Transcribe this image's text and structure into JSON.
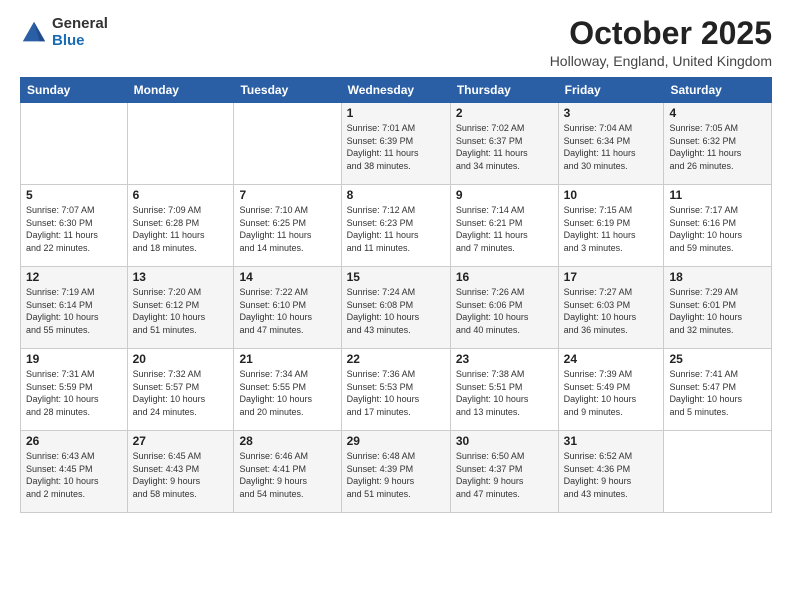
{
  "header": {
    "logo_general": "General",
    "logo_blue": "Blue",
    "month_title": "October 2025",
    "location": "Holloway, England, United Kingdom"
  },
  "days_of_week": [
    "Sunday",
    "Monday",
    "Tuesday",
    "Wednesday",
    "Thursday",
    "Friday",
    "Saturday"
  ],
  "weeks": [
    [
      {
        "num": "",
        "info": ""
      },
      {
        "num": "",
        "info": ""
      },
      {
        "num": "",
        "info": ""
      },
      {
        "num": "1",
        "info": "Sunrise: 7:01 AM\nSunset: 6:39 PM\nDaylight: 11 hours\nand 38 minutes."
      },
      {
        "num": "2",
        "info": "Sunrise: 7:02 AM\nSunset: 6:37 PM\nDaylight: 11 hours\nand 34 minutes."
      },
      {
        "num": "3",
        "info": "Sunrise: 7:04 AM\nSunset: 6:34 PM\nDaylight: 11 hours\nand 30 minutes."
      },
      {
        "num": "4",
        "info": "Sunrise: 7:05 AM\nSunset: 6:32 PM\nDaylight: 11 hours\nand 26 minutes."
      }
    ],
    [
      {
        "num": "5",
        "info": "Sunrise: 7:07 AM\nSunset: 6:30 PM\nDaylight: 11 hours\nand 22 minutes."
      },
      {
        "num": "6",
        "info": "Sunrise: 7:09 AM\nSunset: 6:28 PM\nDaylight: 11 hours\nand 18 minutes."
      },
      {
        "num": "7",
        "info": "Sunrise: 7:10 AM\nSunset: 6:25 PM\nDaylight: 11 hours\nand 14 minutes."
      },
      {
        "num": "8",
        "info": "Sunrise: 7:12 AM\nSunset: 6:23 PM\nDaylight: 11 hours\nand 11 minutes."
      },
      {
        "num": "9",
        "info": "Sunrise: 7:14 AM\nSunset: 6:21 PM\nDaylight: 11 hours\nand 7 minutes."
      },
      {
        "num": "10",
        "info": "Sunrise: 7:15 AM\nSunset: 6:19 PM\nDaylight: 11 hours\nand 3 minutes."
      },
      {
        "num": "11",
        "info": "Sunrise: 7:17 AM\nSunset: 6:16 PM\nDaylight: 10 hours\nand 59 minutes."
      }
    ],
    [
      {
        "num": "12",
        "info": "Sunrise: 7:19 AM\nSunset: 6:14 PM\nDaylight: 10 hours\nand 55 minutes."
      },
      {
        "num": "13",
        "info": "Sunrise: 7:20 AM\nSunset: 6:12 PM\nDaylight: 10 hours\nand 51 minutes."
      },
      {
        "num": "14",
        "info": "Sunrise: 7:22 AM\nSunset: 6:10 PM\nDaylight: 10 hours\nand 47 minutes."
      },
      {
        "num": "15",
        "info": "Sunrise: 7:24 AM\nSunset: 6:08 PM\nDaylight: 10 hours\nand 43 minutes."
      },
      {
        "num": "16",
        "info": "Sunrise: 7:26 AM\nSunset: 6:06 PM\nDaylight: 10 hours\nand 40 minutes."
      },
      {
        "num": "17",
        "info": "Sunrise: 7:27 AM\nSunset: 6:03 PM\nDaylight: 10 hours\nand 36 minutes."
      },
      {
        "num": "18",
        "info": "Sunrise: 7:29 AM\nSunset: 6:01 PM\nDaylight: 10 hours\nand 32 minutes."
      }
    ],
    [
      {
        "num": "19",
        "info": "Sunrise: 7:31 AM\nSunset: 5:59 PM\nDaylight: 10 hours\nand 28 minutes."
      },
      {
        "num": "20",
        "info": "Sunrise: 7:32 AM\nSunset: 5:57 PM\nDaylight: 10 hours\nand 24 minutes."
      },
      {
        "num": "21",
        "info": "Sunrise: 7:34 AM\nSunset: 5:55 PM\nDaylight: 10 hours\nand 20 minutes."
      },
      {
        "num": "22",
        "info": "Sunrise: 7:36 AM\nSunset: 5:53 PM\nDaylight: 10 hours\nand 17 minutes."
      },
      {
        "num": "23",
        "info": "Sunrise: 7:38 AM\nSunset: 5:51 PM\nDaylight: 10 hours\nand 13 minutes."
      },
      {
        "num": "24",
        "info": "Sunrise: 7:39 AM\nSunset: 5:49 PM\nDaylight: 10 hours\nand 9 minutes."
      },
      {
        "num": "25",
        "info": "Sunrise: 7:41 AM\nSunset: 5:47 PM\nDaylight: 10 hours\nand 5 minutes."
      }
    ],
    [
      {
        "num": "26",
        "info": "Sunrise: 6:43 AM\nSunset: 4:45 PM\nDaylight: 10 hours\nand 2 minutes."
      },
      {
        "num": "27",
        "info": "Sunrise: 6:45 AM\nSunset: 4:43 PM\nDaylight: 9 hours\nand 58 minutes."
      },
      {
        "num": "28",
        "info": "Sunrise: 6:46 AM\nSunset: 4:41 PM\nDaylight: 9 hours\nand 54 minutes."
      },
      {
        "num": "29",
        "info": "Sunrise: 6:48 AM\nSunset: 4:39 PM\nDaylight: 9 hours\nand 51 minutes."
      },
      {
        "num": "30",
        "info": "Sunrise: 6:50 AM\nSunset: 4:37 PM\nDaylight: 9 hours\nand 47 minutes."
      },
      {
        "num": "31",
        "info": "Sunrise: 6:52 AM\nSunset: 4:36 PM\nDaylight: 9 hours\nand 43 minutes."
      },
      {
        "num": "",
        "info": ""
      }
    ]
  ]
}
